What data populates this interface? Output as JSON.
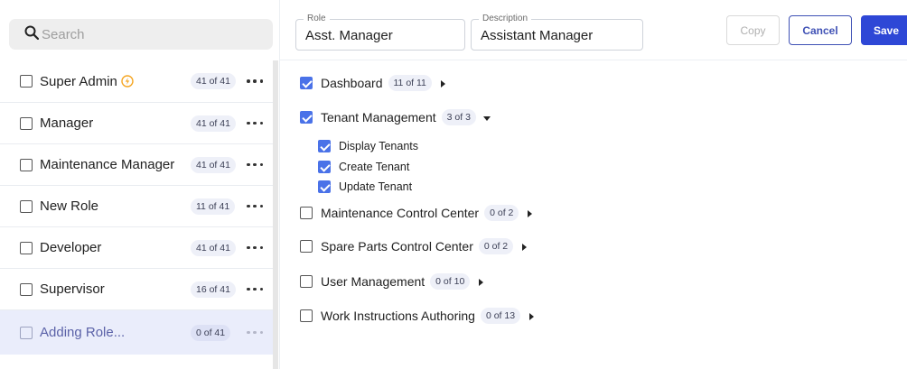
{
  "search": {
    "placeholder": "Search"
  },
  "roles": [
    {
      "name": "Super Admin",
      "count": "41 of 41",
      "starred": true
    },
    {
      "name": "Manager",
      "count": "41 of 41"
    },
    {
      "name": "Maintenance Manager",
      "count": "41 of 41"
    },
    {
      "name": "New Role",
      "count": "11 of 41"
    },
    {
      "name": "Developer",
      "count": "41 of 41"
    },
    {
      "name": "Supervisor",
      "count": "16 of 41"
    },
    {
      "name": "Adding Role...",
      "count": "0 of 41",
      "selected": true
    }
  ],
  "form": {
    "role_label": "Role",
    "role_value": "Asst. Manager",
    "description_label": "Description",
    "description_value": "Assistant Manager"
  },
  "buttons": {
    "copy": "Copy",
    "cancel": "Cancel",
    "save": "Save"
  },
  "permissions": [
    {
      "name": "Dashboard",
      "count": "11 of 11",
      "checked": true,
      "expanded": false
    },
    {
      "name": "Tenant Management",
      "count": "3 of 3",
      "checked": true,
      "expanded": true,
      "children": [
        {
          "name": "Display Tenants",
          "checked": true
        },
        {
          "name": "Create Tenant",
          "checked": true
        },
        {
          "name": "Update Tenant",
          "checked": true
        }
      ]
    },
    {
      "name": "Maintenance Control Center",
      "count": "0 of 2",
      "checked": false,
      "expanded": false
    },
    {
      "name": "Spare Parts Control Center",
      "count": "0 of 2",
      "checked": false,
      "expanded": false
    },
    {
      "name": "User Management",
      "count": "0 of 10",
      "checked": false,
      "expanded": false
    },
    {
      "name": "Work Instructions Authoring",
      "count": "0 of 13",
      "checked": false,
      "expanded": false
    }
  ],
  "colors": {
    "accent": "#2e47d6",
    "checkbox": "#4a72e8",
    "selected_row": "#eaedfb"
  }
}
